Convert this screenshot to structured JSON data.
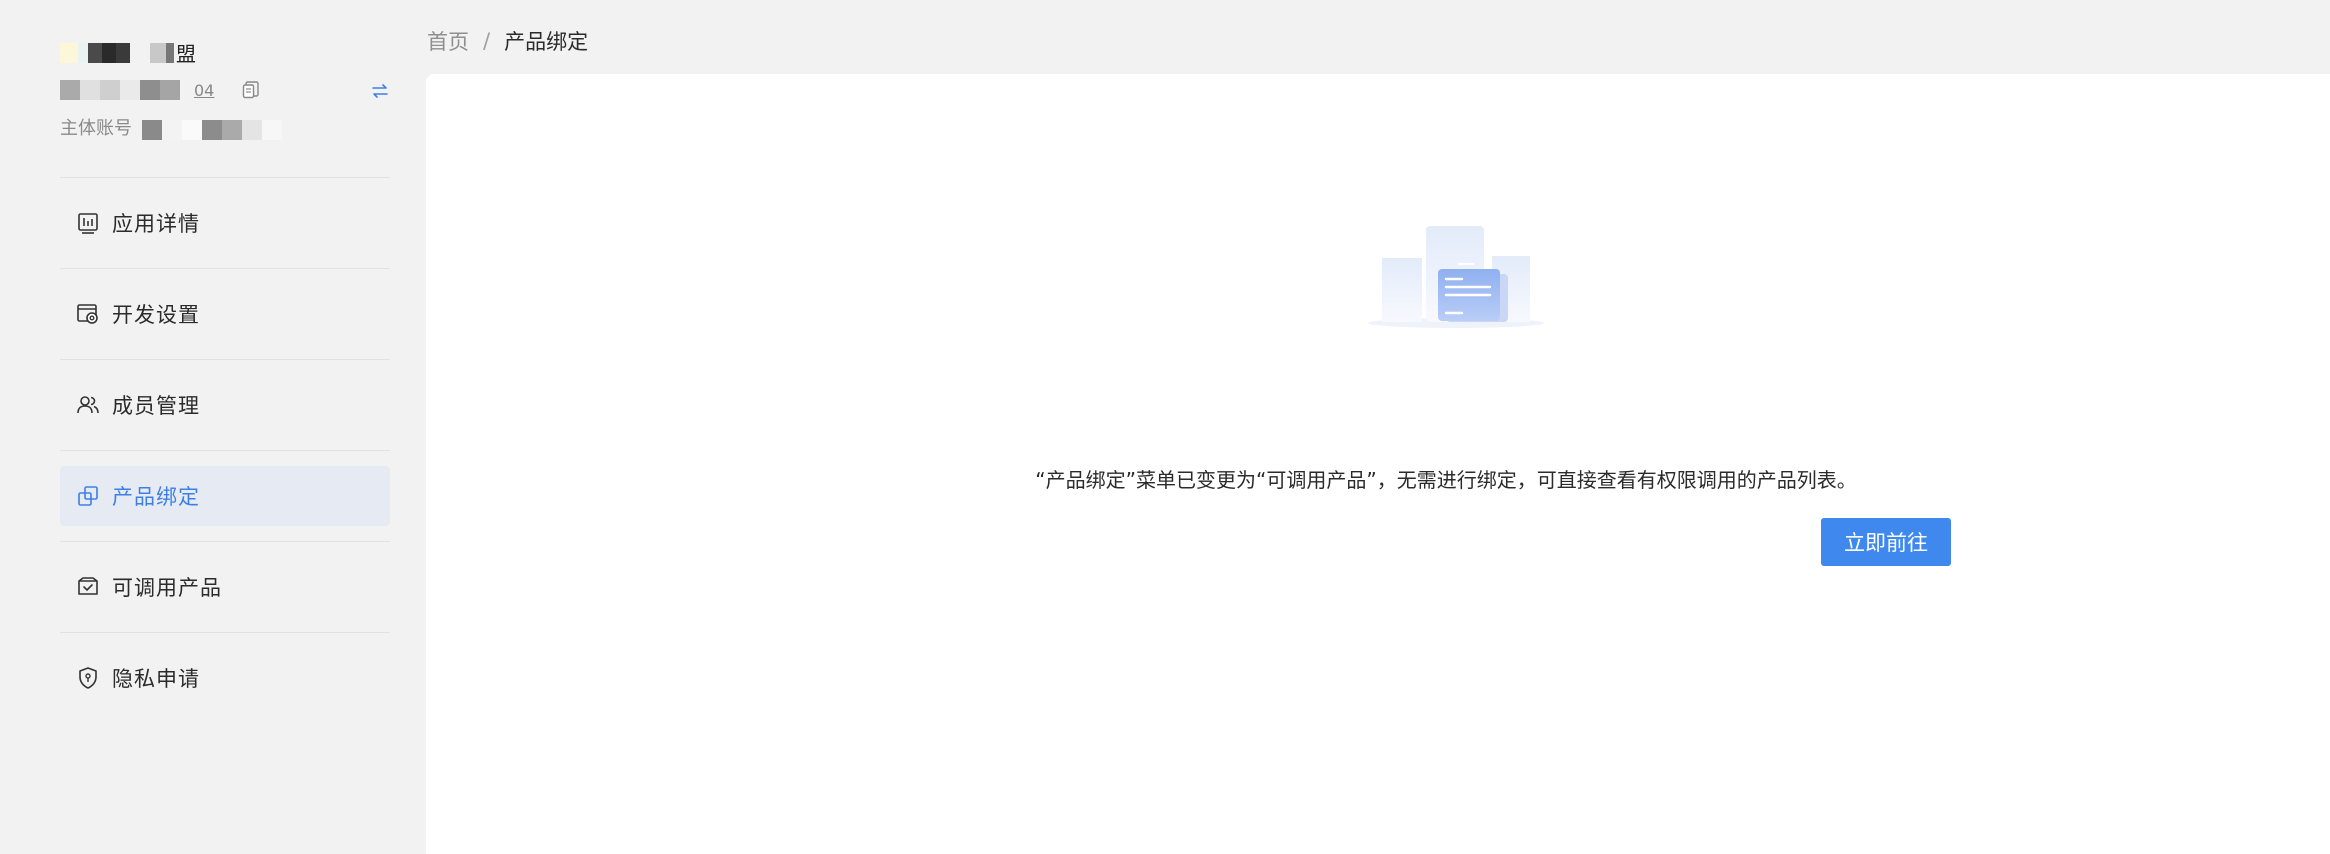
{
  "breadcrumb": {
    "home": "首页",
    "separator": "/",
    "current": "产品绑定"
  },
  "app": {
    "name_tail": "盟",
    "appid_tail": "04",
    "account_label": "主体账号"
  },
  "sidebar": {
    "items": [
      {
        "label": "应用详情",
        "icon": "chart-board-icon",
        "active": false
      },
      {
        "label": "开发设置",
        "icon": "dev-settings-icon",
        "active": false
      },
      {
        "label": "成员管理",
        "icon": "members-icon",
        "active": false
      },
      {
        "label": "产品绑定",
        "icon": "product-bind-icon",
        "active": true
      },
      {
        "label": "可调用产品",
        "icon": "callable-products-icon",
        "active": false
      },
      {
        "label": "隐私申请",
        "icon": "shield-icon",
        "active": false
      }
    ]
  },
  "main": {
    "notice": "“产品绑定”菜单已变更为“可调用产品”，无需进行绑定，可直接查看有权限调用的产品列表。",
    "button_label": "立即前往"
  },
  "colors": {
    "accent": "#3f89ee",
    "active_bg": "#e6ebf3",
    "active_text": "#3d7fe6",
    "page_bg": "#f2f2f2"
  }
}
